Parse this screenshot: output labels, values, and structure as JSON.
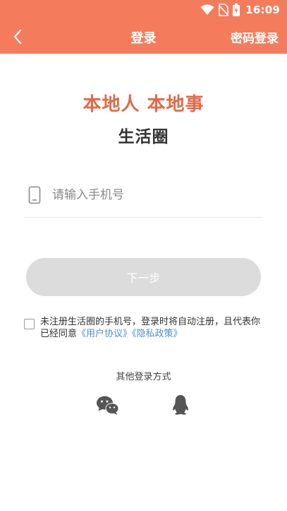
{
  "status_bar": {
    "time": "16:09"
  },
  "nav": {
    "title": "登录",
    "password_login": "密码登录"
  },
  "hero": {
    "slogan": "本地人 本地事",
    "brand": "生活圈"
  },
  "phone_field": {
    "value": "",
    "placeholder": "请输入手机号"
  },
  "next_button": {
    "label": "下一步"
  },
  "agreement": {
    "checked": false,
    "text": "未注册生活圈的手机号，登录时将自动注册，且代表你已经同意",
    "user_agreement": "《用户协议》",
    "privacy_policy": "《隐私政策》"
  },
  "other_login": {
    "label": "其他登录方式",
    "methods": [
      "wechat-icon",
      "qq-icon"
    ]
  },
  "colors": {
    "header": "#F47C5C",
    "slogan": "#E06A48",
    "link": "#4A90C2",
    "disabled_button": "#DCDCDC"
  }
}
